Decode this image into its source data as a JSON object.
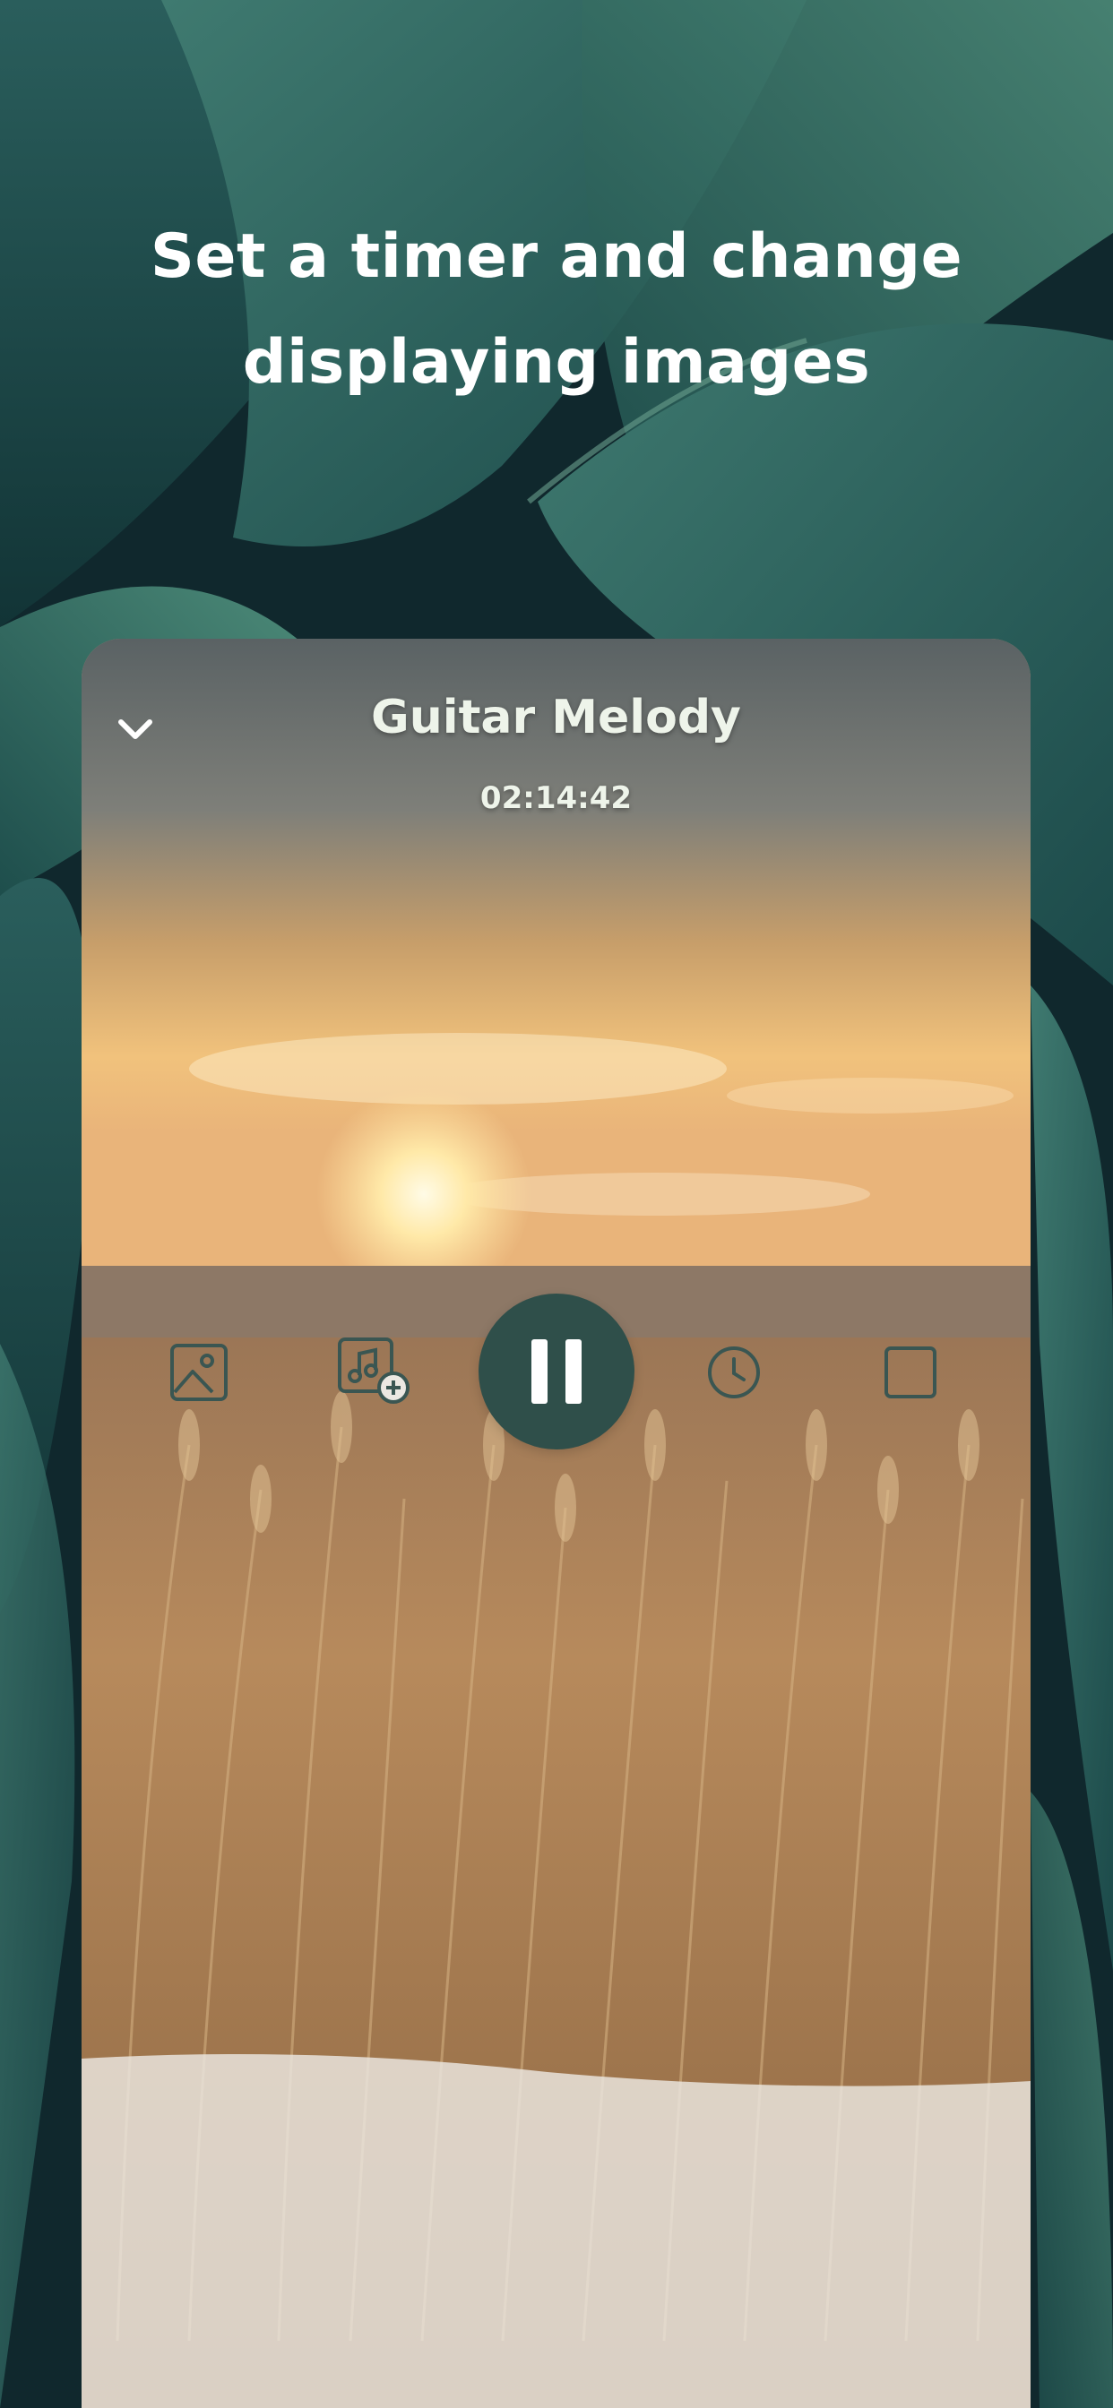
{
  "headline": {
    "line1": "Set a timer and change",
    "line2": "displaying images"
  },
  "player": {
    "track_title": "Guitar Melody",
    "timer": "02:14:42",
    "collapse_icon": "chevron-down-icon",
    "controls": [
      {
        "name": "image-icon",
        "label": "Change image"
      },
      {
        "name": "add-music-icon",
        "label": "Add sound"
      },
      {
        "name": "pause-icon",
        "label": "Pause"
      },
      {
        "name": "clock-icon",
        "label": "Timer"
      },
      {
        "name": "stop-icon",
        "label": "Stop"
      }
    ]
  },
  "colors": {
    "play_button": "#2f4f4a",
    "controls_icon": "#3a5652",
    "title_text": "#eef4ea",
    "background": "#0f2a30"
  }
}
